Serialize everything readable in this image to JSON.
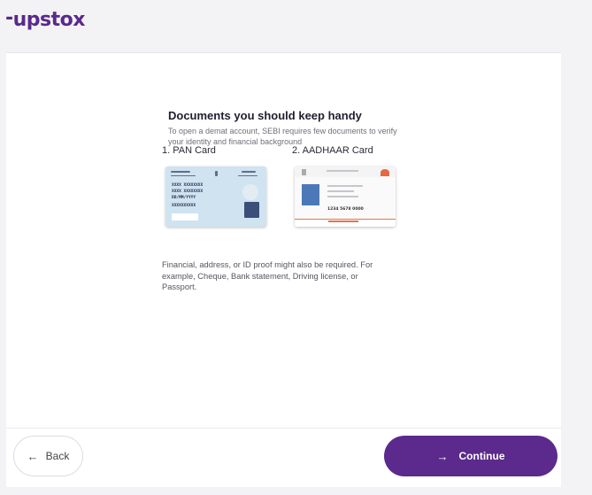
{
  "brand": {
    "logo_text": "upstox",
    "color": "#5a298b"
  },
  "main": {
    "title": "Documents you should keep handy",
    "subtitle": "To open a demat account, SEBI requires few documents to verify your identity and financial background",
    "documents": [
      {
        "label": "1. PAN Card",
        "image": "pan-card-sample"
      },
      {
        "label": "2. AADHAAR Card",
        "image": "aadhaar-card-sample"
      }
    ],
    "note": "Financial, address, or ID proof might also be required. For example, Cheque, Bank statement, Driving license, or Passport."
  },
  "pan_card": {
    "line1": "XXXX XXXXXXXX",
    "line2": "XXXX XXXXXXXX",
    "line3": "DD/MM/YYYY",
    "line4": "XXXXXXXXXX"
  },
  "aadhaar_card": {
    "number": "1234 5678 0000"
  },
  "footer": {
    "back_label": "Back",
    "back_icon": "arrow-left-icon",
    "continue_label": "Continue",
    "continue_icon": "arrow-right-icon",
    "accent_color": "#5b2a8c"
  }
}
